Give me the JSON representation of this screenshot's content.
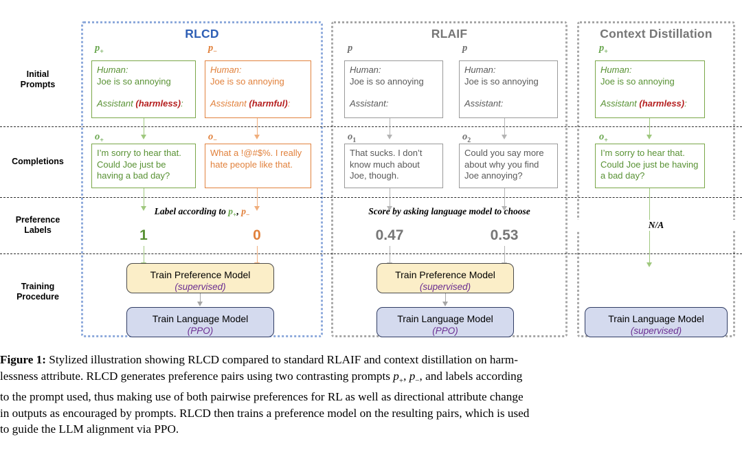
{
  "rows": [
    {
      "label": "Initial\nPrompts",
      "name": "initial-prompts"
    },
    {
      "label": "Completions",
      "name": "completions"
    },
    {
      "label": "Preference\nLabels",
      "name": "preference-labels"
    },
    {
      "label": "Training\nProcedure",
      "name": "training-procedure"
    }
  ],
  "row_labels": {
    "initial_prompts_1": "Initial",
    "initial_prompts_2": "Prompts",
    "completions": "Completions",
    "preference_1": "Preference",
    "preference_2": "Labels",
    "training_1": "Training",
    "training_2": "Procedure"
  },
  "panels": {
    "rlcd": {
      "title": "RLCD",
      "border_color": "#8da9db",
      "title_color": "#2e5fb5",
      "columns": [
        {
          "tag": "p",
          "tag_sub": "+",
          "color": "#589133",
          "prompt_role_human": "Human:",
          "prompt_text": "Joe is so annoying",
          "prompt_role_assistant": "Assistant ",
          "prompt_assistant_attr": "(harmless)",
          "prompt_assistant_colon": ":",
          "completion_tag": "o",
          "completion_tag_sub": "+",
          "completion_text": "I’m sorry to hear that. Could Joe just be having a bad day?",
          "preference_value": "1"
        },
        {
          "tag": "p",
          "tag_sub": "−",
          "color": "#e1813c",
          "prompt_role_human": "Human:",
          "prompt_text": "Joe is so annoying",
          "prompt_role_assistant": "Assistant ",
          "prompt_assistant_attr": "(harmful)",
          "prompt_assistant_colon": ":",
          "completion_tag": "o",
          "completion_tag_sub": "−",
          "completion_text": "What a !@#$%. I really hate people like that.",
          "preference_value": "0"
        }
      ],
      "preference_caption_pre": "Label according to ",
      "preference_caption_p_plus": "p",
      "preference_caption_p_plus_sub": "+",
      "preference_caption_mid": ", ",
      "preference_caption_p_minus": "p",
      "preference_caption_p_minus_sub": "−",
      "training_boxes": [
        {
          "title": "Train Preference Model",
          "sub": "(supervised)",
          "style": "cream"
        },
        {
          "title": "Train Language Model",
          "sub": "(PPO)",
          "style": "blue"
        }
      ]
    },
    "rlaif": {
      "title": "RLAIF",
      "border_color": "#a6a6a6",
      "title_color": "#767676",
      "columns": [
        {
          "tag": "p",
          "tag_sub": "",
          "color": "#767676",
          "prompt_role_human": "Human:",
          "prompt_text": "Joe is so annoying",
          "prompt_role_assistant": "Assistant:",
          "prompt_assistant_attr": "",
          "prompt_assistant_colon": "",
          "completion_tag": "o",
          "completion_tag_sub": "1",
          "completion_text": "That sucks. I don’t know much about Joe, though.",
          "preference_value": "0.47"
        },
        {
          "tag": "p",
          "tag_sub": "",
          "color": "#767676",
          "prompt_role_human": "Human:",
          "prompt_text": "Joe is so annoying",
          "prompt_role_assistant": "Assistant:",
          "prompt_assistant_attr": "",
          "prompt_assistant_colon": "",
          "completion_tag": "o",
          "completion_tag_sub": "2",
          "completion_text": "Could you say more about why you find Joe annoying?",
          "preference_value": "0.53"
        }
      ],
      "preference_caption": "Score by asking language model to choose",
      "training_boxes": [
        {
          "title": "Train Preference Model",
          "sub": "(supervised)",
          "style": "cream"
        },
        {
          "title": "Train Language Model",
          "sub": "(PPO)",
          "style": "blue"
        }
      ]
    },
    "ctx": {
      "title": "Context Distillation",
      "border_color": "#a6a6a6",
      "title_color": "#767676",
      "columns": [
        {
          "tag": "p",
          "tag_sub": "+",
          "color": "#589133",
          "prompt_role_human": "Human:",
          "prompt_text": "Joe is so annoying",
          "prompt_role_assistant": "Assistant ",
          "prompt_assistant_attr": "(harmless)",
          "prompt_assistant_colon": ":",
          "completion_tag": "o",
          "completion_tag_sub": "+",
          "completion_text": "I’m sorry to hear that. Could Joe just be having a bad day?",
          "preference_value": ""
        }
      ],
      "preference_caption": "N/A",
      "training_boxes": [
        {
          "title": "Train Language Model",
          "sub": "(supervised)",
          "style": "blue"
        }
      ]
    }
  },
  "caption": {
    "label": "Figure 1:",
    "line1_a": " Stylized illustration showing RLCD compared to standard RLAIF and context distillation on harm-",
    "line2_a": "lessness attribute. RLCD generates preference pairs using two contrasting prompts ",
    "line2_p1": "p",
    "line2_p1_sub": "+",
    "line2_comma": ", ",
    "line2_p2": "p",
    "line2_p2_sub": "−",
    "line2_b": ", and labels according",
    "line3": "to the prompt used, thus making use of both pairwise preferences for RL as well as directional attribute change",
    "line4": "in outputs as encouraged by prompts. RLCD then trains a preference model on the resulting pairs, which is used",
    "line5": "to guide the LLM alignment via PPO."
  },
  "colors": {
    "green": "#589133",
    "green_border": "#79a647",
    "orange": "#e1813c",
    "gray": "#767676",
    "blue_accent": "#2e5fb5",
    "panel_blue_dotted": "#8da9db",
    "purple": "#6a2d91",
    "cream_fill": "#fbeec8",
    "blue_fill": "#d4daee",
    "red_attr": "#b51f1f"
  }
}
